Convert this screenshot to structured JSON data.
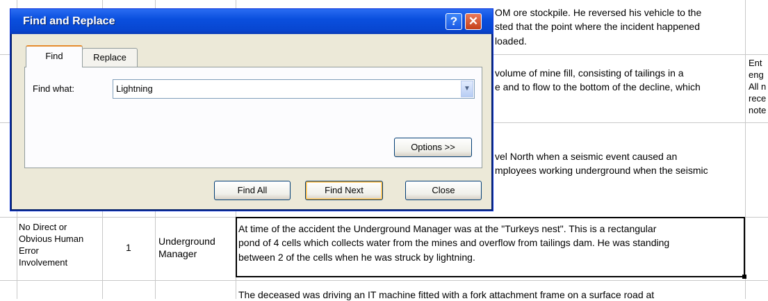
{
  "sheet": {
    "top_right_text": [
      "OM ore stockpile. He reversed his vehicle to the",
      "sted that the point where the incident happened",
      "loaded."
    ],
    "second_text": [
      "volume of mine fill, consisting of tailings in a",
      "e and to flow to the bottom of the decline, which"
    ],
    "far_right_col": [
      "Ent",
      "eng",
      "All n",
      "rece",
      "note"
    ],
    "third_text": [
      "vel North when a seismic event caused an",
      "mployees working underground when the seismic"
    ],
    "row_human_error": [
      "No Direct or",
      "Obvious Human",
      "Error",
      "Involvement"
    ],
    "row_count": "1",
    "row_role": [
      "Underground",
      "Manager"
    ],
    "row_description": [
      "At time of the accident the Underground Manager was at the \"Turkeys nest\". This is a rectangular",
      "pond of 4 cells which collects water from the mines and overflow from tailings dam. He was standing",
      "between 2 of the cells when he was struck by lightning."
    ],
    "bottom_text": "The deceased was driving an IT machine fitted with a fork attachment frame on a surface road at"
  },
  "dialog": {
    "title": "Find and Replace",
    "help_glyph": "?",
    "close_glyph": "✕",
    "tabs": [
      "Find",
      "Replace"
    ],
    "find_what_label": "Find what:",
    "find_value": "Lightning",
    "dropdown_glyph": "▼",
    "options_button": "Options >>",
    "find_all_button": "Find All",
    "find_next_button": "Find Next",
    "close_button": "Close"
  }
}
